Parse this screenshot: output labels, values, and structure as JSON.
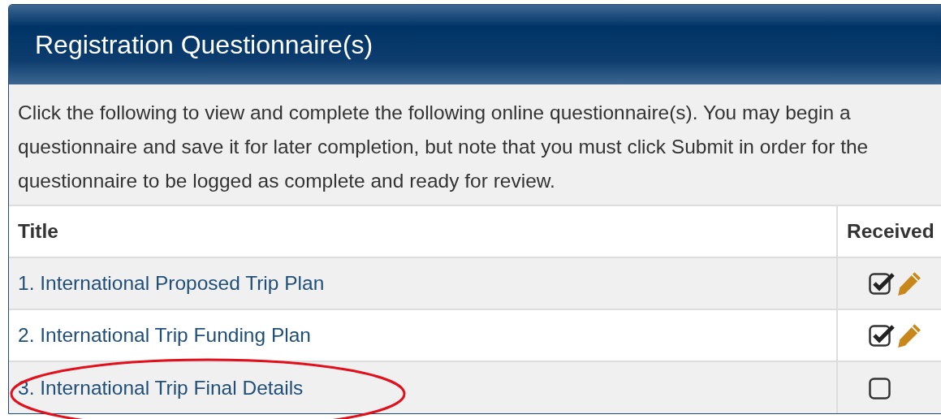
{
  "panel": {
    "title": "Registration Questionnaire(s)"
  },
  "intro": "Click the following to view and complete the following online questionnaire(s). You may begin a questionnaire and save it for later completion, but note that you must click Submit in order for the questionnaire to be logged as complete and ready for review.",
  "table": {
    "columns": [
      "Title",
      "Received"
    ],
    "rows": [
      {
        "title": "1. International Proposed Trip Plan",
        "received": true,
        "editable": true,
        "circled": false
      },
      {
        "title": "2. International Trip Funding Plan",
        "received": true,
        "editable": true,
        "circled": false
      },
      {
        "title": "3. International Trip Final Details",
        "received": false,
        "editable": false,
        "circled": true
      }
    ]
  }
}
